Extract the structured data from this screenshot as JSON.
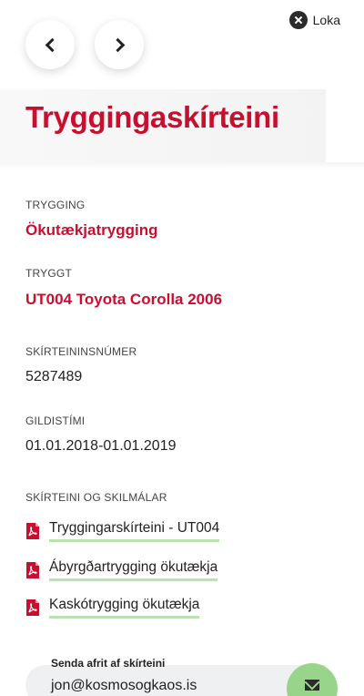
{
  "header": {
    "close_label": "Loka"
  },
  "page": {
    "title": "Tryggingaskírteini"
  },
  "fields": {
    "insurance_label": "TRYGGING",
    "insurance_value": "Ökutækjatrygging",
    "insured_label": "TRYGGT",
    "insured_value": "UT004 Toyota Corolla 2006",
    "certificate_number_label": "SKÍRTEININSNÚMER",
    "certificate_number_value": "5287489",
    "validity_label": "GILDISTÍMI",
    "validity_value": "01.01.2018-01.01.2019"
  },
  "documents": {
    "section_label": "SKÍRTEINI OG SKILMÁLAR",
    "items": [
      {
        "label": "Tryggingarskírteini - UT004",
        "icon": "pdf-icon"
      },
      {
        "label": "Ábyrgðartrygging ökutækja",
        "icon": "pdf-icon"
      },
      {
        "label": "Kaskótrygging ökutækja",
        "icon": "pdf-icon"
      }
    ]
  },
  "send_copy": {
    "label": "Senda afrit af skírteini",
    "email_value": "jon@kosmosogkaos.is",
    "button_icon": "mail-icon"
  },
  "colors": {
    "brand_red": "#c8102e",
    "accent_green": "#98d48a",
    "underline_green": "#b9e3b0"
  }
}
